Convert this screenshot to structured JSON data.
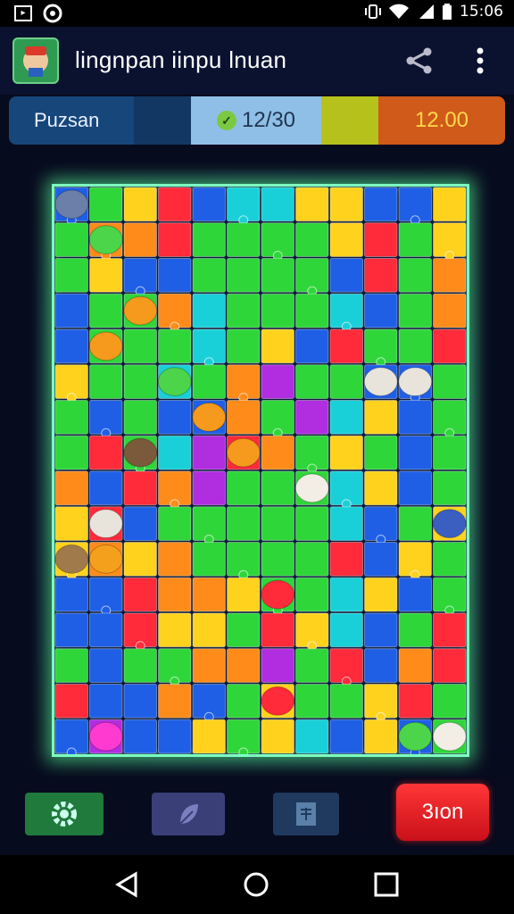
{
  "status_bar": {
    "time": "15:06",
    "left_icons": [
      "screenshot-icon",
      "location-icon"
    ],
    "right_icons": [
      "vibrate-icon",
      "wifi-icon",
      "signal-icon",
      "battery-icon"
    ]
  },
  "app_bar": {
    "title": "lingnpan iinpu lnuan",
    "icons": [
      "app-icon",
      "share-icon",
      "more-vert-icon"
    ]
  },
  "score_bar": {
    "left_label": "Puzsan",
    "progress_label": "12/30",
    "right_value": "12.00",
    "colors": [
      "#17467a",
      "#8fbfe6",
      "#b6c21b",
      "#cf5a1a"
    ]
  },
  "board": {
    "rows": 16,
    "cols": 12,
    "grid": [
      "BGYRBCCYYBBY",
      "GOORGGGGYRGY",
      "GYBBGGGGBRGO",
      "BGGOCGGGCBGO",
      "BGGGCGYBRGGR",
      "YGGCGOPGGBBG",
      "GBGBBOGPCYBG",
      "GRGCPROGYGBG",
      "OBROPGGGCYBG",
      "YRBGGGGGCBGY",
      "YOYOGGGGRBYG",
      "BBROOYGGCYBG",
      "BBRYYGRYCBGR",
      "GBGGOOPGRBOR",
      "RBBOBGYGGYRG",
      "BPBBYGYCBYBG"
    ],
    "palette": {
      "B": "#1f5fe6",
      "C": "#1ad0d8",
      "G": "#2fd63a",
      "Y": "#ffd21e",
      "O": "#ff8c1a",
      "R": "#ff2a3a",
      "P": "#b12de0"
    },
    "animals": [
      "elephant-icon",
      "bear-icon",
      "lion-icon",
      "goat-icon",
      "sheep-icon",
      "bull-icon",
      "dog-icon"
    ]
  },
  "bottom_bar": {
    "buttons": [
      "settings-icon",
      "leaf-icon",
      "book-icon"
    ],
    "action_label": "3ıon"
  },
  "nav_bar": {
    "icons": [
      "back-icon",
      "home-icon",
      "recents-icon"
    ]
  }
}
